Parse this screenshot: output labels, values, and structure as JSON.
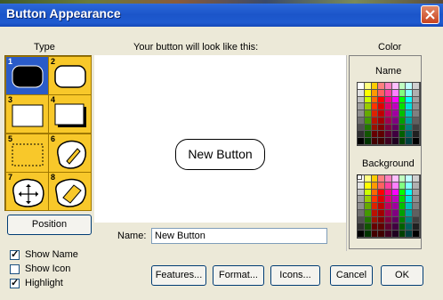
{
  "window": {
    "title": "Button Appearance"
  },
  "type_section": {
    "label": "Type",
    "cells": [
      {
        "num": "1",
        "selected": true
      },
      {
        "num": "2",
        "selected": false
      },
      {
        "num": "3",
        "selected": false
      },
      {
        "num": "4",
        "selected": false
      },
      {
        "num": "5",
        "selected": false
      },
      {
        "num": "6",
        "selected": false
      },
      {
        "num": "7",
        "selected": false
      },
      {
        "num": "8",
        "selected": false
      }
    ]
  },
  "preview": {
    "label": "Your button will look like this:",
    "button_text": "New Button"
  },
  "name_field": {
    "label": "Name:",
    "value": "New Button"
  },
  "color_section": {
    "label": "Color",
    "name_label": "Name",
    "background_label": "Background"
  },
  "position_button": "Position",
  "checkboxes": {
    "show_name": {
      "label": "Show Name",
      "checked": true
    },
    "show_icon": {
      "label": "Show Icon",
      "checked": false
    },
    "highlight": {
      "label": "Highlight",
      "checked": true
    }
  },
  "footer": {
    "features": "Features...",
    "format": "Format...",
    "icons": "Icons...",
    "cancel": "Cancel",
    "ok": "OK"
  },
  "palette_colors": [
    [
      "#ffffff",
      "#ffff80",
      "#ffcc00",
      "#ff8080",
      "#ff80c0",
      "#ffc0ff",
      "#c0ffc0",
      "#c0ffff",
      "#d0d0d0"
    ],
    [
      "#e0e0e0",
      "#ffff00",
      "#ff9900",
      "#ff6060",
      "#ff40a0",
      "#ff80ff",
      "#80ff80",
      "#80ffff",
      "#b0b0b0"
    ],
    [
      "#c0c0c0",
      "#ccff00",
      "#ff6600",
      "#ff0000",
      "#ff0080",
      "#ff00ff",
      "#00ff00",
      "#00ffff",
      "#a0a0a0"
    ],
    [
      "#a0a0a0",
      "#99cc00",
      "#ff3300",
      "#e00000",
      "#e00070",
      "#c000c0",
      "#00e000",
      "#00e0e0",
      "#909090"
    ],
    [
      "#909090",
      "#66aa00",
      "#dd2200",
      "#c00000",
      "#c00060",
      "#a000a0",
      "#00c000",
      "#00c0c0",
      "#808080"
    ],
    [
      "#707070",
      "#449900",
      "#bb1100",
      "#a00000",
      "#a00050",
      "#800080",
      "#00a000",
      "#00a0a0",
      "#606060"
    ],
    [
      "#505050",
      "#227700",
      "#991100",
      "#800000",
      "#800040",
      "#600060",
      "#008000",
      "#008080",
      "#404040"
    ],
    [
      "#303030",
      "#115500",
      "#660000",
      "#600000",
      "#600030",
      "#400040",
      "#006000",
      "#006060",
      "#202020"
    ],
    [
      "#000000",
      "#003300",
      "#440000",
      "#400000",
      "#400020",
      "#200020",
      "#004000",
      "#004040",
      "#000000"
    ]
  ]
}
